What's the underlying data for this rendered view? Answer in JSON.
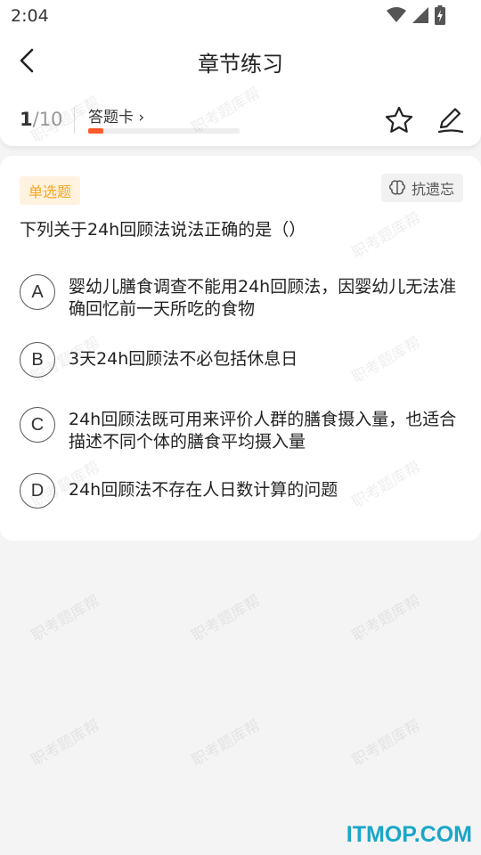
{
  "status_bar": {
    "time": "2:04"
  },
  "nav": {
    "title": "章节练习"
  },
  "progress": {
    "current": "1",
    "total": "/10",
    "card_label": "答题卡",
    "card_chevron": "›",
    "fraction": 0.1
  },
  "question": {
    "type_label": "单选题",
    "anti_forget_label": "抗遗忘",
    "text": "下列关于24h回顾法说法正确的是（）",
    "options": [
      {
        "letter": "A",
        "text": "婴幼儿膳食调查不能用24h回顾法，因婴幼儿无法准确回忆前一天所吃的食物"
      },
      {
        "letter": "B",
        "text": "3天24h回顾法不必包括休息日"
      },
      {
        "letter": "C",
        "text": "24h回顾法既可用来评价人群的膳食摄入量，也适合描述不同个体的膳食平均摄入量"
      },
      {
        "letter": "D",
        "text": "24h回顾法不存在人日数计算的问题"
      }
    ]
  },
  "watermark_text": "职考题库帮",
  "brand_mark": "ITMOP.COM",
  "colors": {
    "accent": "#ff5a2d",
    "badge_text": "#f5a623",
    "badge_bg": "#fff3e0"
  },
  "icons": [
    "wifi-icon",
    "signal-icon",
    "battery-icon",
    "back-arrow-icon",
    "star-icon",
    "edit-icon",
    "brain-icon"
  ]
}
